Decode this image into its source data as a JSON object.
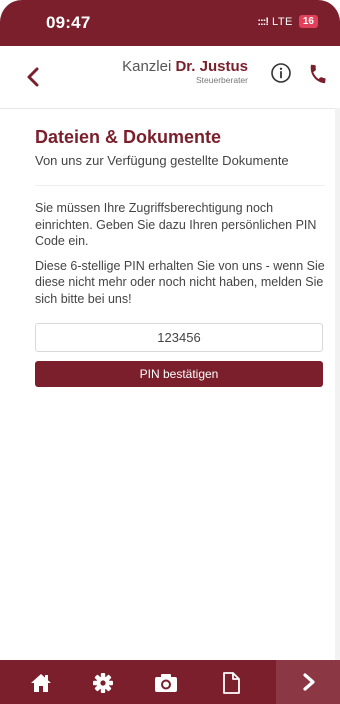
{
  "status_bar": {
    "time": "09:47",
    "signal": ":::!",
    "network": "LTE",
    "battery": "16"
  },
  "header": {
    "brand_prefix": "Kanzlei",
    "brand_name": "Dr. Justus",
    "brand_subtitle": "Steuerberater",
    "icons": {
      "back": "chevron-left-icon",
      "info": "info-icon",
      "phone": "phone-icon"
    }
  },
  "main": {
    "title": "Dateien & Dokumente",
    "subtitle": "Von uns zur Verfügung gestellte Dokumente",
    "paragraph1": "Sie müssen Ihre Zugriffsberechtigung noch einrichten. Geben Sie dazu Ihren persönlichen PIN Code ein.",
    "paragraph2": "Diese 6-stellige PIN erhalten Sie von uns - wenn Sie diese nicht mehr oder noch nicht haben, melden Sie sich bitte bei uns!",
    "pin_value": "123456",
    "confirm_label": "PIN bestätigen"
  },
  "tab_bar": {
    "items": [
      {
        "icon": "home-icon"
      },
      {
        "icon": "gear-icon"
      },
      {
        "icon": "camera-icon"
      },
      {
        "icon": "document-icon"
      },
      {
        "icon": "chevron-right-icon"
      }
    ]
  },
  "colors": {
    "brand": "#7a1f2b",
    "battery_low": "#e1405a",
    "next_tab": "#8b3744"
  }
}
